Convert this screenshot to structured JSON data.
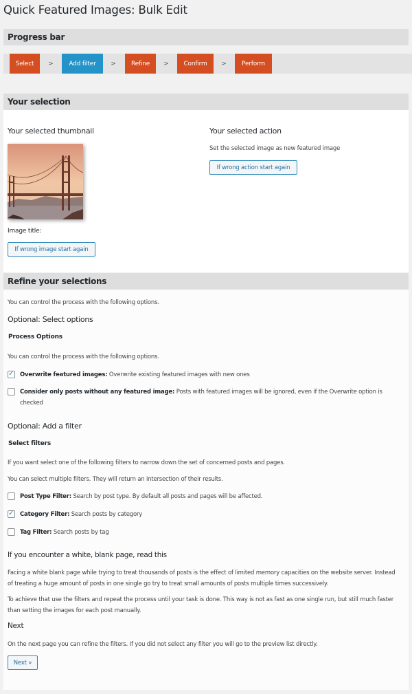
{
  "page": {
    "title": "Quick Featured Images: Bulk Edit"
  },
  "progress": {
    "header": "Progress bar",
    "separator": ">",
    "steps": [
      {
        "label": "Select",
        "state": "done"
      },
      {
        "label": "Add filter",
        "state": "active"
      },
      {
        "label": "Refine",
        "state": "pending"
      },
      {
        "label": "Confirm",
        "state": "pending"
      },
      {
        "label": "Perform",
        "state": "pending"
      }
    ],
    "colors": {
      "step": "#d54e21",
      "active": "#2493c8"
    }
  },
  "selection": {
    "header": "Your selection",
    "thumbnail_heading": "Your selected thumbnail",
    "image_title_label": "Image title:",
    "wrong_image_button": "If wrong image start again",
    "action_heading": "Your selected action",
    "action_text": "Set the selected image as new featured image",
    "wrong_action_button": "If wrong action start again"
  },
  "refine": {
    "header": "Refine your selections",
    "intro": "You can control the process with the following options.",
    "options_heading": "Optional: Select options",
    "process_options_heading": "Process Options",
    "process_intro": "You can control the process with the following options.",
    "options": [
      {
        "label": "Overwrite featured images:",
        "desc": "Overwrite existing featured images with new ones",
        "checked": true
      },
      {
        "label": "Consider only posts without any featured image:",
        "desc": "Posts with featured images will be ignored, even if the Overwrite option is checked",
        "checked": false
      }
    ],
    "filter_heading": "Optional: Add a filter",
    "select_filters_heading": "Select filters",
    "filter_intro1": "If you want select one of the following filters to narrow down the set of concerned posts and pages.",
    "filter_intro2": "You can select multiple filters. They will return an intersection of their results.",
    "filters": [
      {
        "label": "Post Type Filter:",
        "desc": "Search by post type. By default all posts and pages will be affected.",
        "checked": false
      },
      {
        "label": "Category Filter:",
        "desc": "Search posts by category",
        "checked": true
      },
      {
        "label": "Tag Filter:",
        "desc": "Search posts by tag",
        "checked": false
      }
    ],
    "blank_heading": "If you encounter a white, blank page, read this",
    "blank_text1": "Facing a white blank page while trying to treat thousands of posts is the effect of limited memory capacities on the website server. Instead of treating a huge amount of posts in one single go try to treat small amounts of posts multiple times successively.",
    "blank_text2": "To achieve that use the filters and repeat the process until your task is done. This way is not as fast as one single run, but still much faster than setting the images for each post manually.",
    "next_heading": "Next",
    "next_text": "On the next page you can refine the filters. If you did not select any filter you will go to the preview list directly.",
    "next_button": "Next »"
  }
}
